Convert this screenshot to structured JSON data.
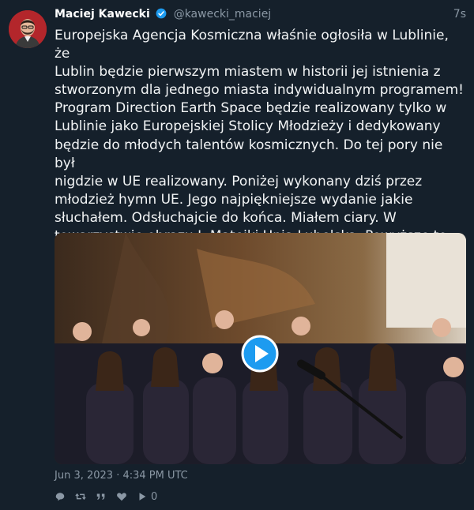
{
  "tweet": {
    "author_name": "Maciej Kawecki",
    "author_handle": "@kawecki_maciej",
    "relative_time": "7s",
    "body": "Europejska Agencja Kosmiczna właśnie ogłosiła w Lublinie, że\nLublin będzie pierwszym miastem w historii jej istnienia z\nstworzonym dla jednego miasta indywidualnym programem!\nProgram Direction Earth Space będzie realizowany tylko w\nLublinie jako Europejskiej Stolicy Młodzieży i dedykowany\nbędzie do młodych talentów kosmicznych. Do tej pory nie był\nnigdzie w UE realizowany. Poniżej wykonany dziś przez\nmłodzież hymn UE. Jego najpiękniejsze wydanie jakie\nsłuchałem. Odsłuchajcie do końca. Miałem ciary. W\ntowarzystwie obrazu J. Matejki Unia Lubelska. Powyższe to\npiękna sprawa. Wykorzystajmy to.",
    "date": "Jun 3, 2023 · 4:34 PM UTC",
    "play_count": "0"
  },
  "icons": [
    "verified-icon",
    "play-icon",
    "reply-icon",
    "retweet-icon",
    "quote-icon",
    "like-icon",
    "views-icon"
  ],
  "colors": {
    "background": "#15202b",
    "accent": "#1d9bf0",
    "muted": "#8b98a5"
  }
}
